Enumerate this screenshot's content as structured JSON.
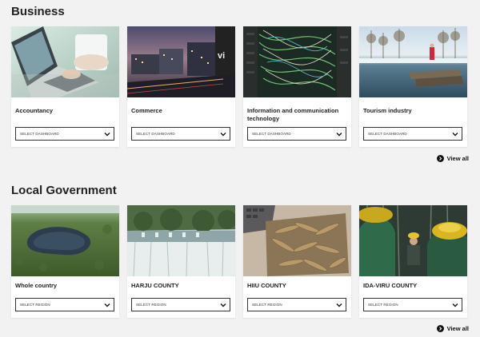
{
  "sections": [
    {
      "title": "Business",
      "view_all": "View all",
      "cards": [
        {
          "title": "Accountancy",
          "select": "SELECT DASHBOARD",
          "image": "laptop-office-photo"
        },
        {
          "title": "Commerce",
          "select": "SELECT DASHBOARD",
          "image": "city-evening-photo"
        },
        {
          "title": "Information and communication technology",
          "select": "SELECT DASHBOARD",
          "image": "server-cables-photo"
        },
        {
          "title": "Tourism industry",
          "select": "SELECT DASHBOARD",
          "image": "winter-lake-photo"
        }
      ]
    },
    {
      "title": "Local Government",
      "view_all": "View all",
      "cards": [
        {
          "title": "Whole country",
          "select": "SELECT REGION",
          "image": "forest-lake-aerial-photo"
        },
        {
          "title": "HARJU COUNTY",
          "select": "SELECT REGION",
          "image": "waterfall-photo"
        },
        {
          "title": "HIIU COUNTY",
          "select": "SELECT REGION",
          "image": "sprats-tin-photo"
        },
        {
          "title": "IDA-VIRU COUNTY",
          "select": "SELECT REGION",
          "image": "miners-helmets-photo"
        }
      ]
    }
  ]
}
